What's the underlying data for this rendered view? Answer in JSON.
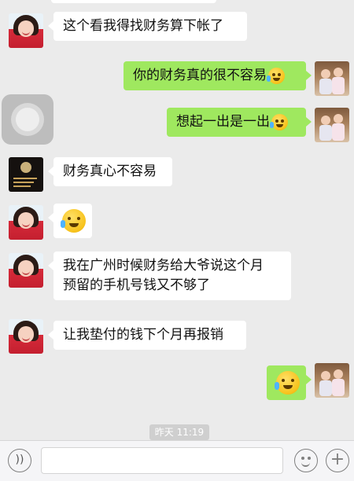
{
  "messages": [
    {
      "side": "left",
      "avatar": "girl-avatar",
      "text": "这个看我得找财务算下帐了"
    },
    {
      "side": "right",
      "avatar": "kids-avatar",
      "text": "你的财务真的很不容易",
      "emoji": "crying-laugh-emoji"
    },
    {
      "side": "right",
      "avatar": "kids-avatar",
      "text": "想起一出是一出",
      "emoji": "tears-of-joy-emoji"
    },
    {
      "side": "left",
      "avatar": "dark-photo-avatar",
      "text": "财务真心不容易"
    },
    {
      "side": "left",
      "avatar": "girl-avatar",
      "emoji": "crying-laugh-emoji"
    },
    {
      "side": "left",
      "avatar": "girl-avatar",
      "lines": [
        "我在广州时候财务给大爷说这个月",
        "预留的手机号钱又不够了"
      ]
    },
    {
      "side": "left",
      "avatar": "girl-avatar",
      "text": "让我垫付的钱下个月再报销"
    },
    {
      "side": "right",
      "avatar": "kids-avatar",
      "emoji": "tears-of-joy-emoji"
    }
  ],
  "timestamp": "昨天 11:19",
  "input_bar": {
    "voice_icon": "voice-icon",
    "input_value": "",
    "emoji_icon": "smiley-icon",
    "plus_icon": "plus-icon"
  },
  "colors": {
    "background": "#ebebeb",
    "incoming_bubble": "#ffffff",
    "outgoing_bubble": "#9fe85f"
  }
}
